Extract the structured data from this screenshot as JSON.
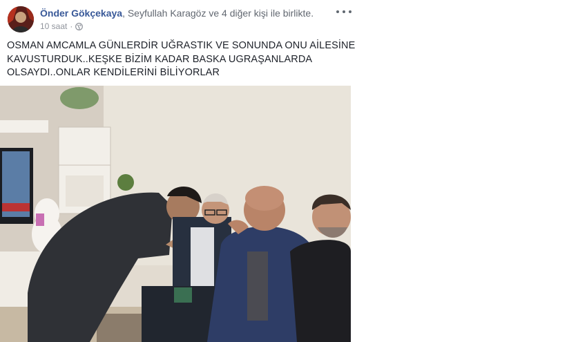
{
  "post": {
    "author": "Önder Gökçekaya",
    "tag_prefix": ", ",
    "tagged_person": "Seyfullah Karagöz",
    "tag_suffix": " ve 4 diğer kişi ile birlikte.",
    "time": "10 saat",
    "separator": "·",
    "privacy_icon": "globe-icon",
    "more_icon": "more-options-icon",
    "text_lines": [
      "OSMAN AMCAMLA GÜNLERDİR UĞRASTIK VE SONUNDA ONU AİLESİNE",
      "KAVUSTURDUK..KEŞKE BİZİM KADAR BASKA UGRAŞANLARDA",
      "OLSAYDI..ONLAR KENDİLERİNİ BİLİYORLAR"
    ]
  }
}
